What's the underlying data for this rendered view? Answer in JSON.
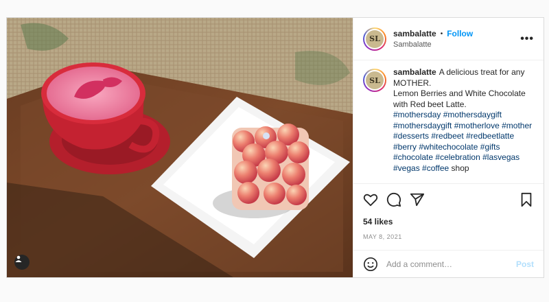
{
  "post": {
    "username": "sambalatte",
    "location": "Sambalatte",
    "follow_label": "Follow",
    "more_label": "•••",
    "avatar_initials": "SL",
    "caption_username": "sambalatte",
    "caption_text": "A delicious treat for any MOTHER.",
    "caption_text_2": "Lemon Berries and White Chocolate with Red beet Latte.",
    "hashtags": [
      "#mothersday",
      "#mothersdaygift",
      "#mothersdaygift",
      "#motherlove",
      "#mother",
      "#desserts",
      "#redbeet",
      "#redbeetlatte",
      "#berry",
      "#whitechocolate",
      "#gifts",
      "#chocolate",
      "#celebration",
      "#lasvegas",
      "#vegas",
      "#coffee"
    ],
    "trailing_text": "shop",
    "likes": "54 likes",
    "date": "MAY 8, 2021",
    "comment_placeholder": "Add a comment…",
    "post_label": "Post"
  },
  "icons": {
    "like": "heart-icon",
    "comment": "comment-icon",
    "share": "share-icon",
    "save": "bookmark-icon",
    "emoji": "emoji-icon",
    "user_tag": "user-tag-icon"
  },
  "colors": {
    "link": "#0095f6",
    "hashtag": "#00376b",
    "post_disabled": "#b2dffc"
  }
}
